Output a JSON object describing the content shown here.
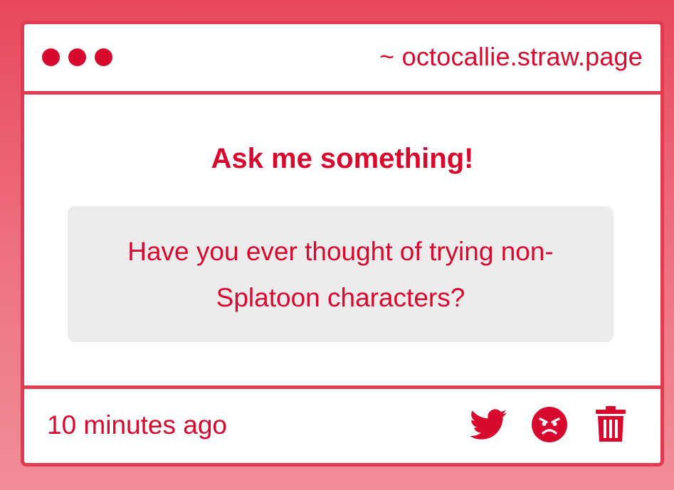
{
  "window": {
    "url": "~ octocallie.straw.page"
  },
  "main": {
    "heading": "Ask me something!",
    "question": "Have you ever thought of trying non-Splatoon characters?"
  },
  "footer": {
    "timestamp": "10 minutes ago",
    "actions": [
      {
        "icon": "twitter-icon"
      },
      {
        "icon": "angry-face-icon"
      },
      {
        "icon": "trash-icon"
      }
    ]
  },
  "colors": {
    "accent": "#d70a2e",
    "border": "#e23a4e",
    "question_bg": "#edebec",
    "background_top": "#e8485d",
    "background_bottom": "#f18d99"
  }
}
